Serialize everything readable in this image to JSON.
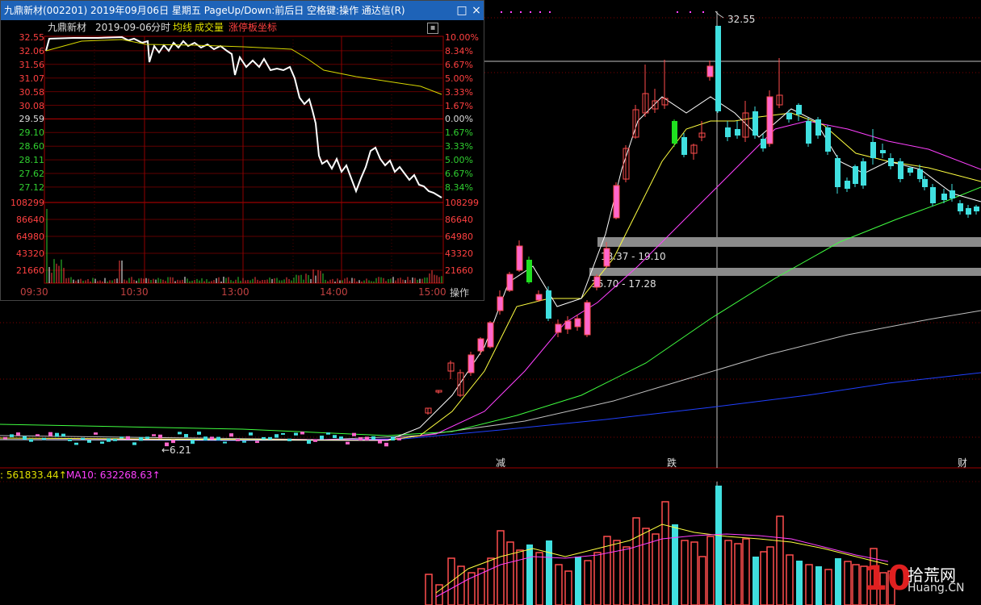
{
  "popup": {
    "title": "九鼎新材(002201) 2019年09月06日 星期五 PageUp/Down:前后日 空格键:操作 通达信(R)",
    "stock_name": "九鼎新材",
    "date": "2019-09-06",
    "mode": "分时",
    "avg_label": "均线",
    "volume_label": "成交量",
    "limit_label": "涨停板坐标",
    "operate_label": "操作",
    "minimize_label": "□",
    "close_label": "×",
    "price_ticks": [
      "32.55",
      "32.06",
      "31.56",
      "31.07",
      "30.58",
      "30.08",
      "29.59",
      "29.10",
      "28.60",
      "28.11",
      "27.62",
      "27.12"
    ],
    "pct_ticks": [
      "10.00%",
      "8.34%",
      "6.67%",
      "5.00%",
      "3.33%",
      "1.67%",
      "0.00%",
      "1.67%",
      "3.33%",
      "5.00%",
      "6.67%",
      "8.34%"
    ],
    "vol_ticks": [
      "108299",
      "86640",
      "64980",
      "43320",
      "21660"
    ],
    "time_ticks": [
      "09:30",
      "10:30",
      "13:00",
      "14:00",
      "15:00"
    ],
    "colors": {
      "up": "#ff4040",
      "down": "#30d030",
      "neutral": "#ffffff",
      "price_line": "#ffffff",
      "avg_line": "#d8d800"
    }
  },
  "main_chart": {
    "price_high_label": "32.55",
    "price_low_label": "6.21",
    "gap_zones": [
      "18.37 - 19.10",
      "16.70 - 17.28"
    ],
    "markers": [
      "减",
      "跌",
      "财"
    ],
    "ma_labels": [
      {
        "text": ": 561833.44↑",
        "color": "#e0e000"
      },
      {
        "text": "MA10: 632268.63↑",
        "color": "#ff40ff"
      }
    ],
    "colors": {
      "up": "#ff4d4d",
      "up_fill": "#ff66cc",
      "down": "#40e0e0",
      "down_big": "#20e020",
      "ma5": "#ffffff",
      "ma10": "#ffff40",
      "ma20": "#ff40ff",
      "ma60": "#40ff40",
      "ma120": "#c0c0c0",
      "ma250": "#2040ff"
    }
  },
  "watermark": {
    "logo": "10",
    "cn": "拾荒网",
    "en": "Huang.CN"
  }
}
